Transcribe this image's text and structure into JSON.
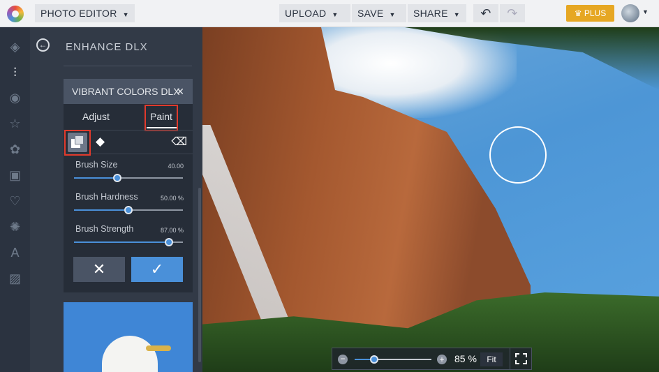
{
  "topbar": {
    "app_menu": "PHOTO EDITOR",
    "upload": "UPLOAD",
    "save": "SAVE",
    "share": "SHARE",
    "plus": "PLUS",
    "undo": "↶",
    "redo": "↷"
  },
  "panel": {
    "title": "ENHANCE DLX",
    "card_title": "VIBRANT COLORS DLX",
    "tabs": [
      {
        "label": "Adjust"
      },
      {
        "label": "Paint"
      }
    ],
    "sliders": [
      {
        "label": "Brush Size",
        "value": "40.00",
        "fraction": 0.4
      },
      {
        "label": "Brush Hardness",
        "value": "50.00 %",
        "fraction": 0.5
      },
      {
        "label": "Brush Strength",
        "value": "87.00 %",
        "fraction": 0.87
      }
    ],
    "cancel": "✕",
    "apply": "✓"
  },
  "zoom": {
    "value": "85 %",
    "fit": "Fit",
    "fraction": 0.25
  },
  "colors": {
    "accent": "#4a90d9",
    "plus": "#e6a723",
    "highlight": "#e13a2c"
  }
}
